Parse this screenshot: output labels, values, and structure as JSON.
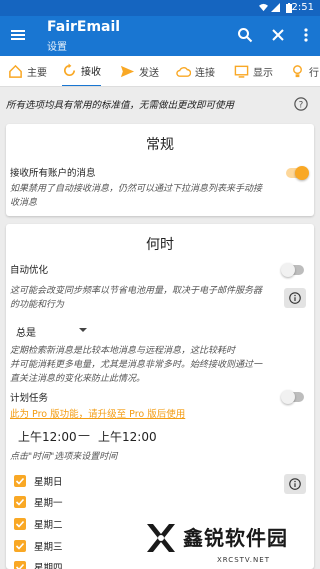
{
  "status_bar": {
    "time": "2:51"
  },
  "app_bar": {
    "title": "FairEmail",
    "subtitle": "设置"
  },
  "tabs": [
    {
      "label": "主要",
      "icon": "home-icon"
    },
    {
      "label": "接收",
      "icon": "sync-icon",
      "active": true
    },
    {
      "label": "发送",
      "icon": "send-icon"
    },
    {
      "label": "连接",
      "icon": "cloud-icon"
    },
    {
      "label": "显示",
      "icon": "monitor-icon"
    },
    {
      "label": "行",
      "icon": "bulb-icon"
    }
  ],
  "intro": "所有选项均具有常用的标准值，无需做出更改即可使用",
  "general": {
    "title": "常规",
    "enabled_label": "接收所有账户的消息",
    "enabled_on": true,
    "note": [
      "如果禁用了自动接收消息，仍然可以通过下拉消息列表来手动接",
      "收消息"
    ]
  },
  "when": {
    "title": "何时",
    "optimize_label": "自动优化",
    "optimize_on": false,
    "optimize_note": [
      "这可能会改变同步频率以节省电池用量，取决于电子邮件服务器",
      "的功能和行为"
    ],
    "poll_value": "总是",
    "poll_note": [
      "定期检索新消息是比较本地消息与远程消息，这比较耗时",
      "并可能消耗更多电量，尤其是消息非常多时。始终接收则通过一",
      "直关注消息的变化来防止此情况。"
    ],
    "schedule_label": "计划任务",
    "schedule_on": false,
    "pro_link": "此为 Pro 版功能，请升级至 Pro 版后使用",
    "time_start": "上午12:00",
    "time_sep": "—",
    "time_end": "上午12:00",
    "time_hint": "点击\"时间\"选项来设置时间",
    "days": [
      "星期日",
      "星期一",
      "星期二",
      "星期三",
      "星期四"
    ]
  },
  "watermark": {
    "text": "鑫锐软件园",
    "url": "XRCSTV.NET"
  },
  "colors": {
    "primary": "#1976d2",
    "status": "#1565c0",
    "accent": "#f9a825",
    "link": "#f39c12"
  }
}
